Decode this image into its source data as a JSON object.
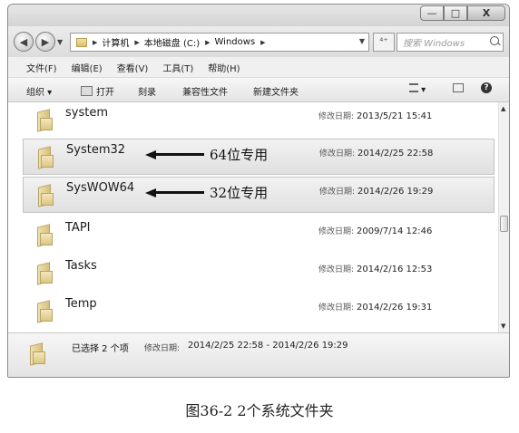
{
  "window": {
    "caption_buttons": {
      "minimize": "—",
      "maximize": "□",
      "close": "X"
    }
  },
  "address_bar": {
    "back_icon": "back-arrow-icon",
    "forward_icon": "forward-arrow-icon",
    "breadcrumbs": [
      "计算机",
      "本地磁盘 (C:)",
      "Windows"
    ],
    "refresh_label": "⁴⁺",
    "search_placeholder": "搜索 Windows"
  },
  "menu": [
    "文件(F)",
    "编辑(E)",
    "查看(V)",
    "工具(T)",
    "帮助(H)"
  ],
  "toolbar": {
    "organize": "组织 ▾",
    "open": "打开",
    "burn": "刻录",
    "compat_files": "兼容性文件",
    "new_folder": "新建文件夹",
    "view_icon": "view-options-icon",
    "preview_icon": "preview-pane-icon",
    "help_icon": "help-icon"
  },
  "date_label": "修改日期:",
  "files": [
    {
      "name": "system",
      "modified": "2013/5/21 15:41",
      "selected": false,
      "annotation": ""
    },
    {
      "name": "System32",
      "modified": "2014/2/25 22:58",
      "selected": true,
      "annotation": "64位专用"
    },
    {
      "name": "SysWOW64",
      "modified": "2014/2/26 19:29",
      "selected": true,
      "annotation": "32位专用"
    },
    {
      "name": "TAPI",
      "modified": "2009/7/14 12:46",
      "selected": false,
      "annotation": ""
    },
    {
      "name": "Tasks",
      "modified": "2014/2/16 12:53",
      "selected": false,
      "annotation": ""
    },
    {
      "name": "Temp",
      "modified": "2014/2/26 19:31",
      "selected": false,
      "annotation": ""
    }
  ],
  "details": {
    "selected_text": "已选择 2 个项",
    "date_label": "修改日期:",
    "date_range": "2014/2/25 22:58 - 2014/2/26 19:29"
  },
  "figure_caption": "图36-2    2个系统文件夹",
  "colors": {
    "selection": "#e6e6e6",
    "window_frame": "#8a8a8a",
    "folder": "#dcc684"
  }
}
